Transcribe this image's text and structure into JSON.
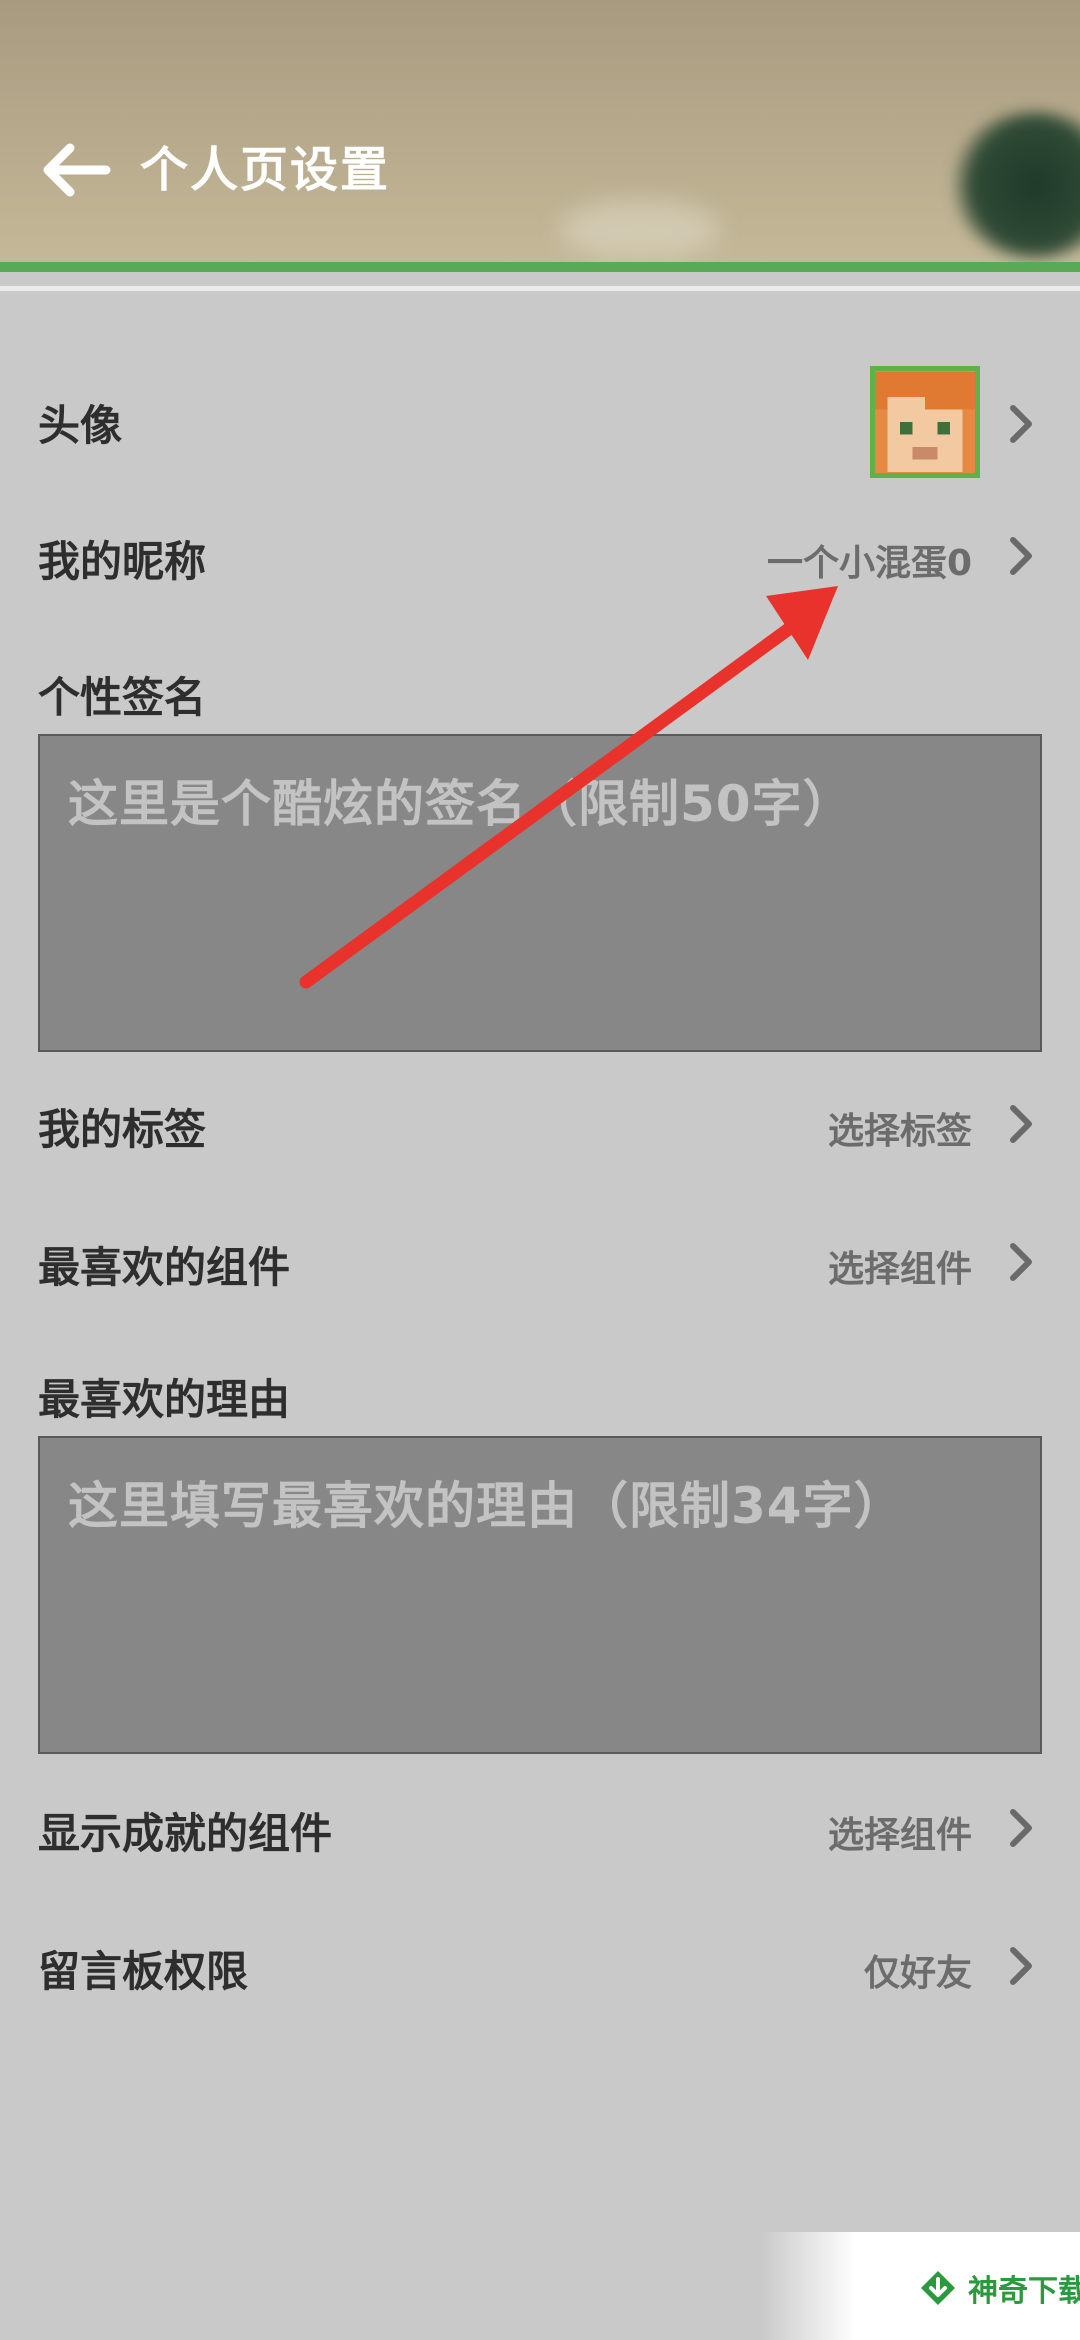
{
  "header": {
    "title": "个人页设置"
  },
  "rows": {
    "avatar": {
      "label": "头像"
    },
    "nickname": {
      "label": "我的昵称",
      "value": "一个小混蛋0"
    },
    "signature": {
      "label": "个性签名",
      "placeholder": "这里是个酷炫的签名（限制50字）"
    },
    "tags": {
      "label": "我的标签",
      "value": "选择标签"
    },
    "fav_component": {
      "label": "最喜欢的组件",
      "value": "选择组件"
    },
    "fav_reason": {
      "label": "最喜欢的理由",
      "placeholder": "这里填写最喜欢的理由（限制34字）"
    },
    "achievement": {
      "label": "显示成就的组件",
      "value": "选择组件"
    },
    "board": {
      "label": "留言板权限",
      "value": "仅好友"
    }
  },
  "watermark": {
    "text": "神奇下载"
  },
  "colors": {
    "accent_green": "#5aa955",
    "arrow_red": "#e8322b"
  }
}
